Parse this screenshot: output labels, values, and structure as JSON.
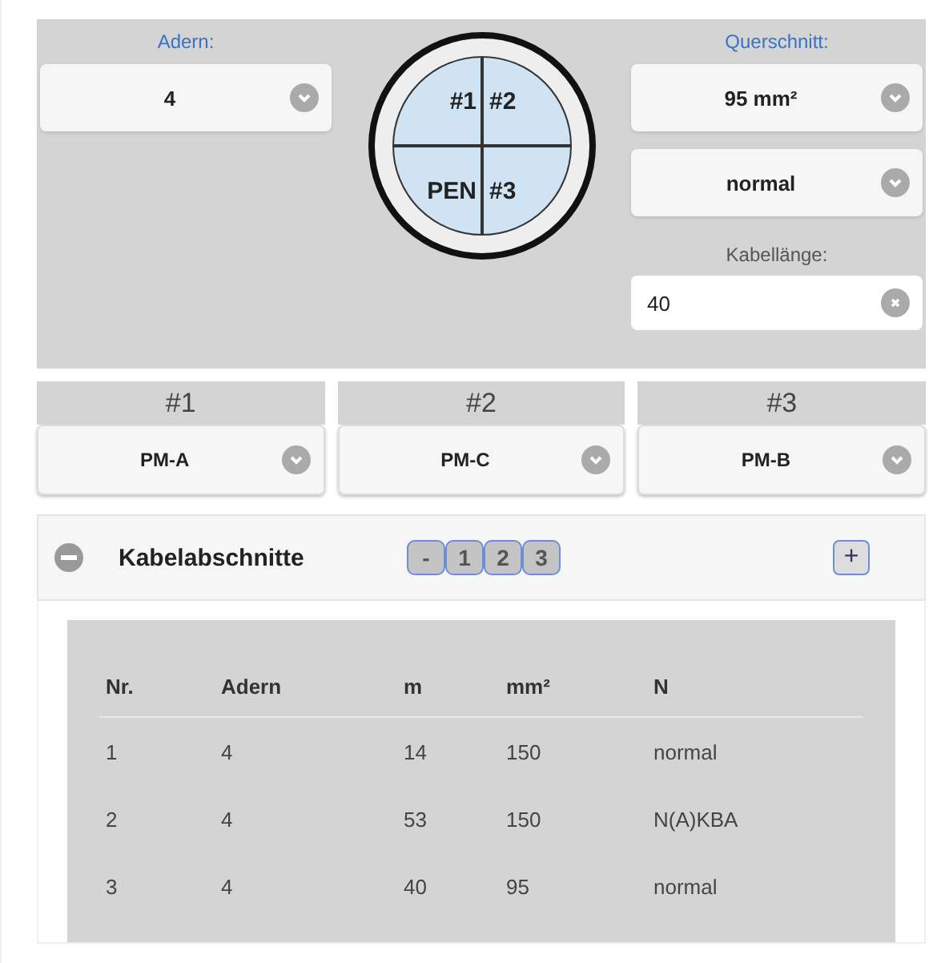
{
  "cable": {
    "adern_label": "Adern:",
    "adern_value": "4",
    "querschnitt_label": "Querschnitt:",
    "querschnitt_value": "95 mm²",
    "type_value": "normal",
    "length_label": "Kabellänge:",
    "length_value": "40"
  },
  "diagram": {
    "conductors": [
      "#1",
      "#2",
      "PEN",
      "#3"
    ]
  },
  "phases": [
    {
      "header": "#1",
      "value": "PM-A"
    },
    {
      "header": "#2",
      "value": "PM-C"
    },
    {
      "header": "#3",
      "value": "PM-B"
    }
  ],
  "section": {
    "title": "Kabelabschnitte",
    "expanded": true,
    "pager": [
      "-",
      "1",
      "2",
      "3"
    ],
    "add": "+"
  },
  "table": {
    "columns": [
      "Nr.",
      "Adern",
      "m",
      "mm²",
      "N"
    ],
    "rows": [
      [
        "1",
        "4",
        "14",
        "150",
        "normal"
      ],
      [
        "2",
        "4",
        "53",
        "150",
        "N(A)KBA"
      ],
      [
        "3",
        "4",
        "40",
        "95",
        "normal"
      ]
    ]
  }
}
